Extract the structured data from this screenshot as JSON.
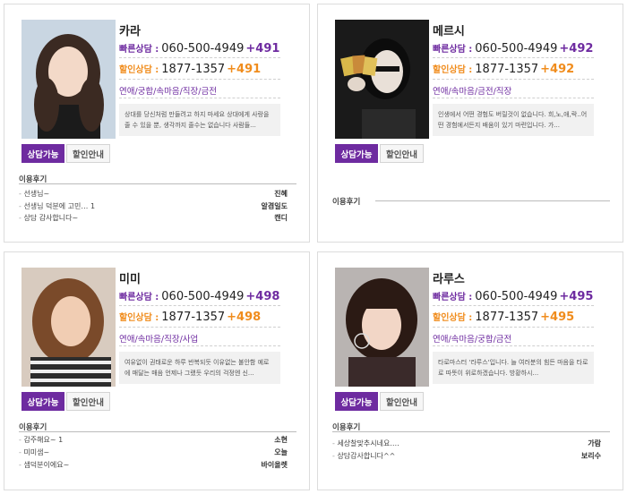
{
  "labels": {
    "fast": "빠른상담 :",
    "discount": "할인상담 :",
    "consult_available": "상담가능",
    "discount_info": "할인안내",
    "reviews": "이용후기"
  },
  "counselors": [
    {
      "name": "카라",
      "fast_number": "060-500-4949",
      "fast_ext": "+491",
      "discount_number": "1877-1357",
      "discount_ext": "+491",
      "categories": "연애/궁합/속마음/직장/금전",
      "description": "상대를 당신처럼 만들려고 하지 마세요 상대에게 사랑을 줄 수 있을 뿐, 생각까지 줄수는 없습니다 사람들...",
      "reviews": [
        {
          "text": "선생님~",
          "writer": "진혜"
        },
        {
          "text": "선생님 덕분에 고민…  1",
          "writer": "알겸일도"
        },
        {
          "text": "상담 감사합니다~",
          "writer": "캔디"
        }
      ]
    },
    {
      "name": "메르시",
      "fast_number": "060-500-4949",
      "fast_ext": "+492",
      "discount_number": "1877-1357",
      "discount_ext": "+492",
      "categories": "연애/속마음/금전/직장",
      "description": "인생에서 어떤 경험도 버릴것이 없습니다. 희,노,애,락..어떤 경험에서든지 배움이 있기 마련입니다. 가...",
      "reviews": []
    },
    {
      "name": "미미",
      "fast_number": "060-500-4949",
      "fast_ext": "+498",
      "discount_number": "1877-1357",
      "discount_ext": "+498",
      "categories": "연애/속마음/직장/사업",
      "description": "여유없이 권태로운 하루 반복되듯 이유없는 불안함 예로 에 매달는 매음 언제나 그랬듯 우리의 걱정엔 신...",
      "reviews": [
        {
          "text": "감주해요~  1",
          "writer": "소현"
        },
        {
          "text": "미미샘~",
          "writer": "오늘"
        },
        {
          "text": "샘덕분이에요~",
          "writer": "바이올렛"
        }
      ]
    },
    {
      "name": "라루스",
      "fast_number": "060-500-4949",
      "fast_ext": "+495",
      "discount_number": "1877-1357",
      "discount_ext": "+495",
      "categories": "연애/속마음/궁합/금전",
      "description": "타로마스터 '라루스'입니다. 늘 여러분의 힘든 마음을 타로 로 따뜻이 위로하겠습니다. 방황하시...",
      "reviews": [
        {
          "text": "세상찰맞추시네요.…",
          "writer": "가람"
        },
        {
          "text": "상담감사합니다^^",
          "writer": "보리수"
        }
      ]
    }
  ]
}
